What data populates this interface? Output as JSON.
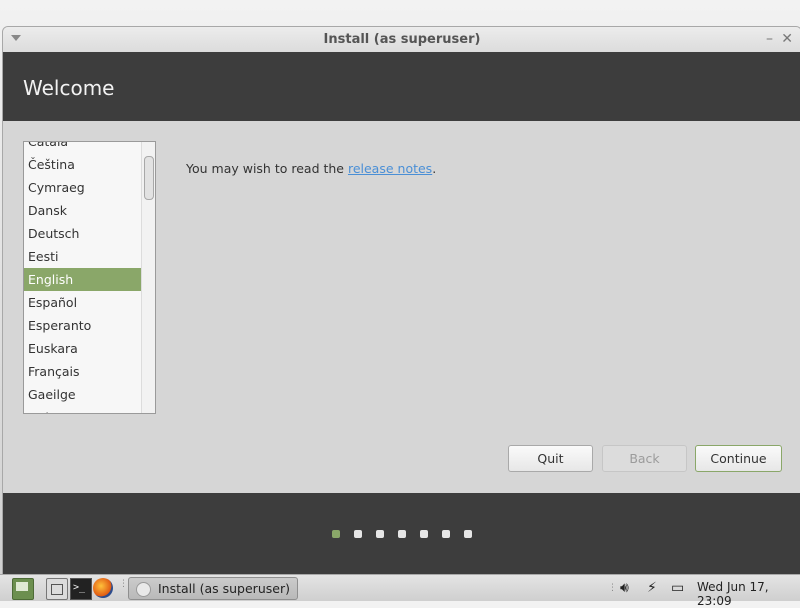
{
  "window": {
    "title": "Install (as superuser)",
    "min_glyph": "–",
    "close_glyph": "✕"
  },
  "header": {
    "title": "Welcome"
  },
  "languages": [
    "Català",
    "Čeština",
    "Cymraeg",
    "Dansk",
    "Deutsch",
    "Eesti",
    "English",
    "Español",
    "Esperanto",
    "Euskara",
    "Français",
    "Gaeilge",
    "Galego"
  ],
  "selected_language": "English",
  "notes": {
    "prefix": "You may wish to read the ",
    "link": "release notes",
    "suffix": "."
  },
  "buttons": {
    "quit": "Quit",
    "back": "Back",
    "continue": "Continue"
  },
  "progress": {
    "steps": 7,
    "current": 1
  },
  "colors": {
    "accent": "#8aa769",
    "header_bg": "#3d3d3d",
    "link": "#4a8fd6"
  },
  "taskbar": {
    "task_label": "Install (as superuser)",
    "terminal_glyph": ">_",
    "clock": "Wed Jun 17, 23:09",
    "icons": [
      "mint-menu-icon",
      "file-manager-icon",
      "terminal-icon",
      "firefox-icon",
      "volume-icon",
      "network-icon",
      "battery-icon"
    ]
  }
}
